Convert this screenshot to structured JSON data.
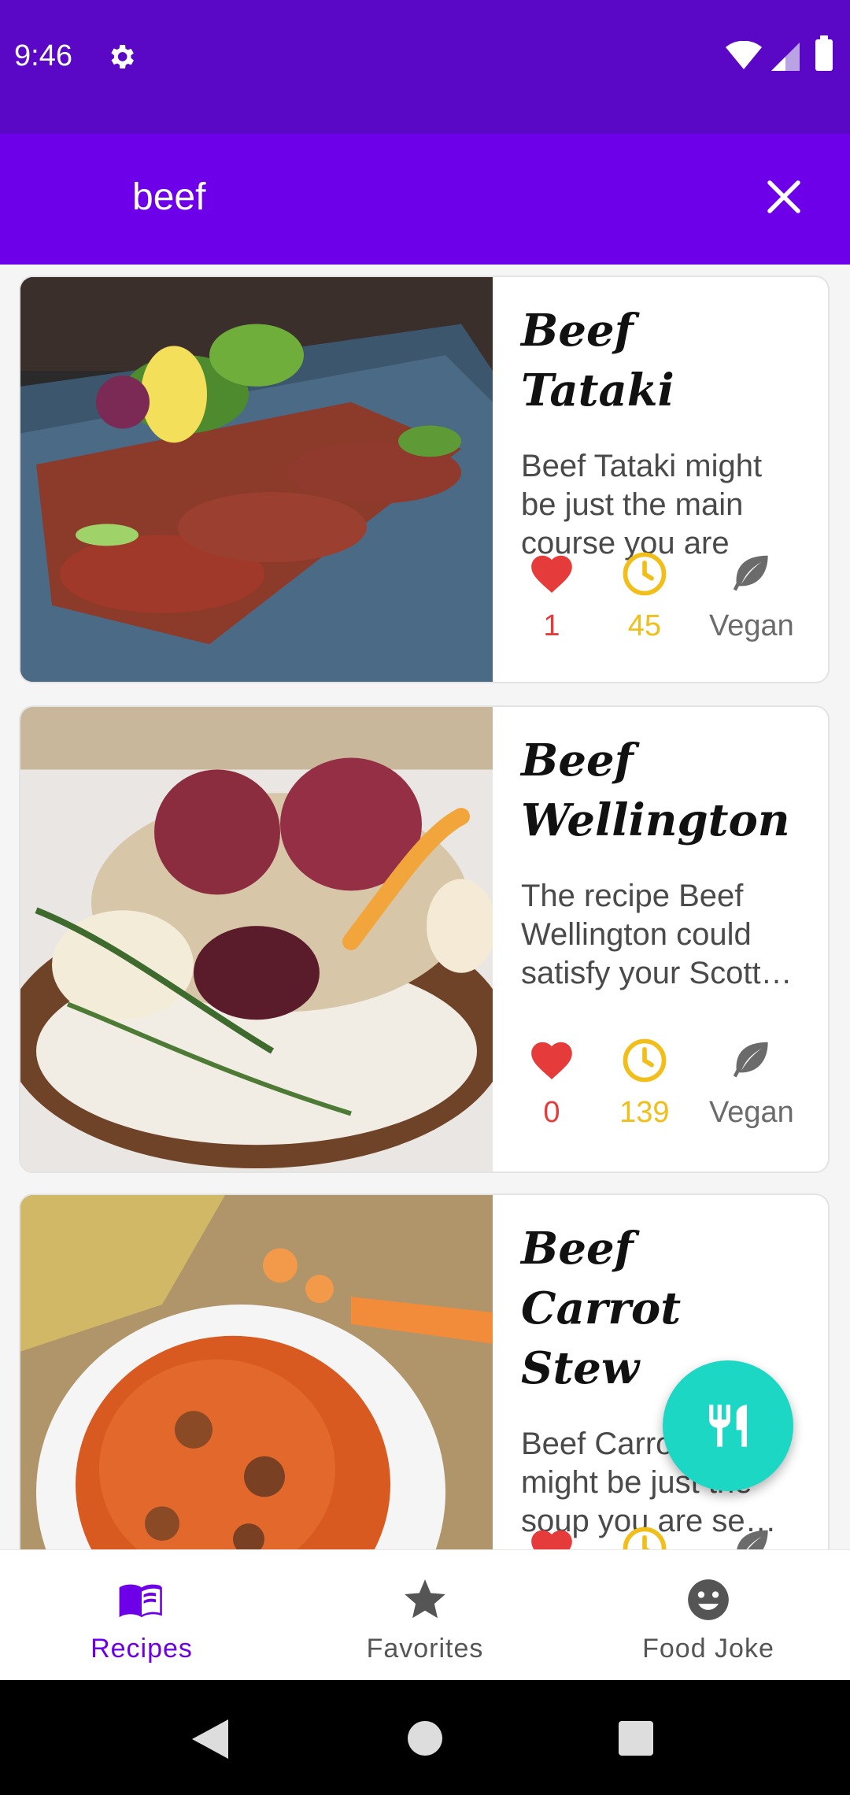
{
  "status": {
    "time": "9:46"
  },
  "search": {
    "query": "beef"
  },
  "recipes": [
    {
      "title": "Beef Tataki",
      "description": "Beef Tataki might be just the main course you are se…",
      "likes": "1",
      "minutes": "45",
      "vegan_label": "Vegan"
    },
    {
      "title": "Beef Wellington",
      "description": "The recipe Beef Wellington could satisfy your Scott…",
      "likes": "0",
      "minutes": "139",
      "vegan_label": "Vegan"
    },
    {
      "title": "Beef Carrot Stew",
      "description": "Beef Carrot Stew might be just the soup you are se…",
      "likes": "",
      "minutes": "",
      "vegan_label": ""
    }
  ],
  "bottom_nav": {
    "recipes": "Recipes",
    "favorites": "Favorites",
    "food_joke": "Food Joke"
  },
  "colors": {
    "status_bar": "#5a08c6",
    "app_bar": "#6d00e8",
    "fab": "#1bd7c3",
    "like": "#e63b3b",
    "time": "#f2bf1a",
    "vegan": "#6b6b6b"
  }
}
